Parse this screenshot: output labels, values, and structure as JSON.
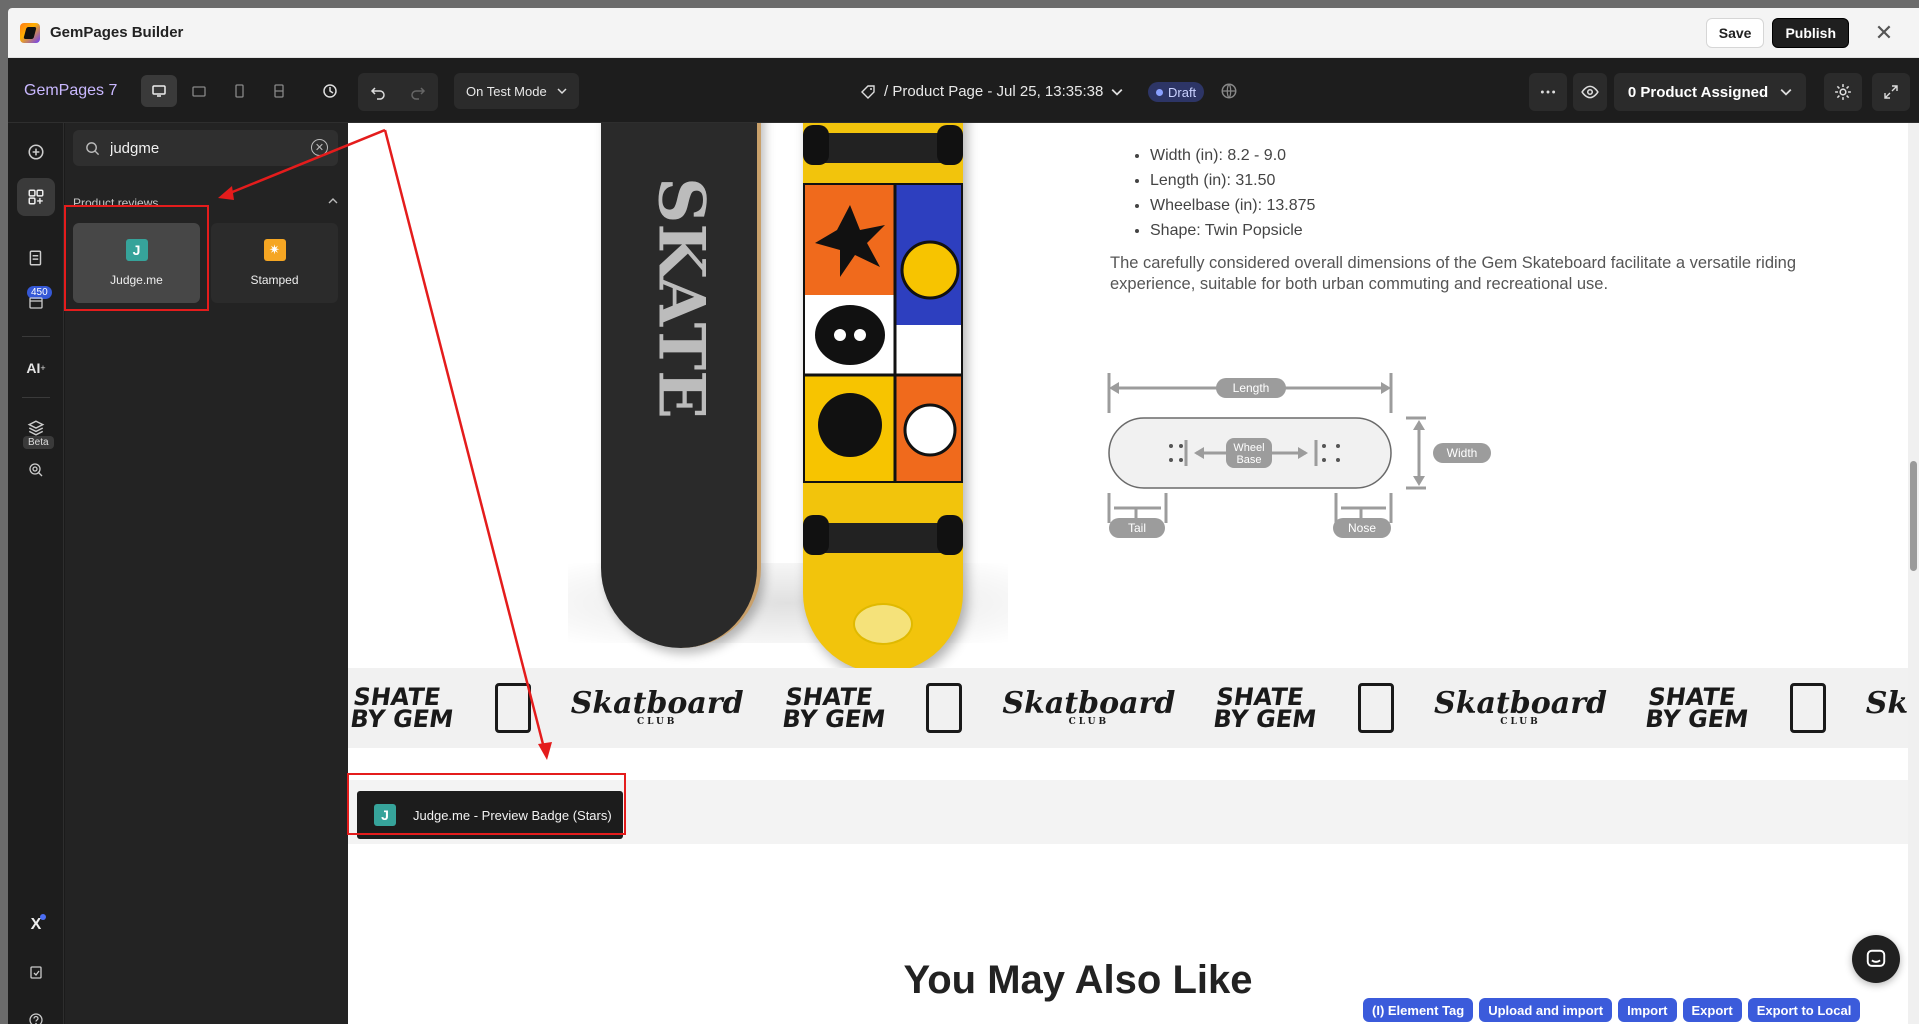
{
  "window": {
    "title": "GemPages Builder",
    "save_label": "Save",
    "publish_label": "Publish"
  },
  "toolbar": {
    "brand": "GemPages 7",
    "mode_label": "On Test Mode",
    "page_title": "/ Product Page - Jul 25, 13:35:38",
    "status": "Draft",
    "assigned_label": "0 Product Assigned"
  },
  "rail": {
    "badge_count": "450",
    "beta_label": "Beta",
    "ai_label": "AI"
  },
  "panel": {
    "search_value": "judgme",
    "section_title": "Product reviews",
    "items": [
      {
        "label": "Judge.me",
        "icon": "J"
      },
      {
        "label": "Stamped",
        "icon": "star-burst-icon"
      }
    ]
  },
  "canvas": {
    "specs": [
      "Width (in): 8.2 - 9.0",
      "Length (in): 31.50",
      "Wheelbase (in): 13.875",
      "Shape: Twin Popsicle"
    ],
    "description": "The carefully considered overall dimensions of the Gem Skateboard facilitate a versatile riding experience, suitable for both urban commuting and recreational use.",
    "diagram_labels": {
      "length": "Length",
      "width": "Width",
      "wheelbase_line1": "Wheel",
      "wheelbase_line2": "Base",
      "tail": "Tail",
      "nose": "Nose"
    },
    "marquee": {
      "skate_line1": "SHATE",
      "skate_line2": "BY GEM",
      "club": "Skatboard",
      "club_sub": "CLUB"
    },
    "judge_badge_label": "Judge.me - Preview Badge (Stars)",
    "section_heading": "You May Also Like"
  },
  "bottom_buttons": [
    "(I) Element Tag",
    "Upload and import",
    "Import",
    "Export",
    "Export to Local"
  ],
  "colors": {
    "accent_blue": "#3b5bdb",
    "annotation_red": "#e41c1c",
    "judge_green": "#36a39a",
    "board_yellow": "#f2c40c"
  }
}
